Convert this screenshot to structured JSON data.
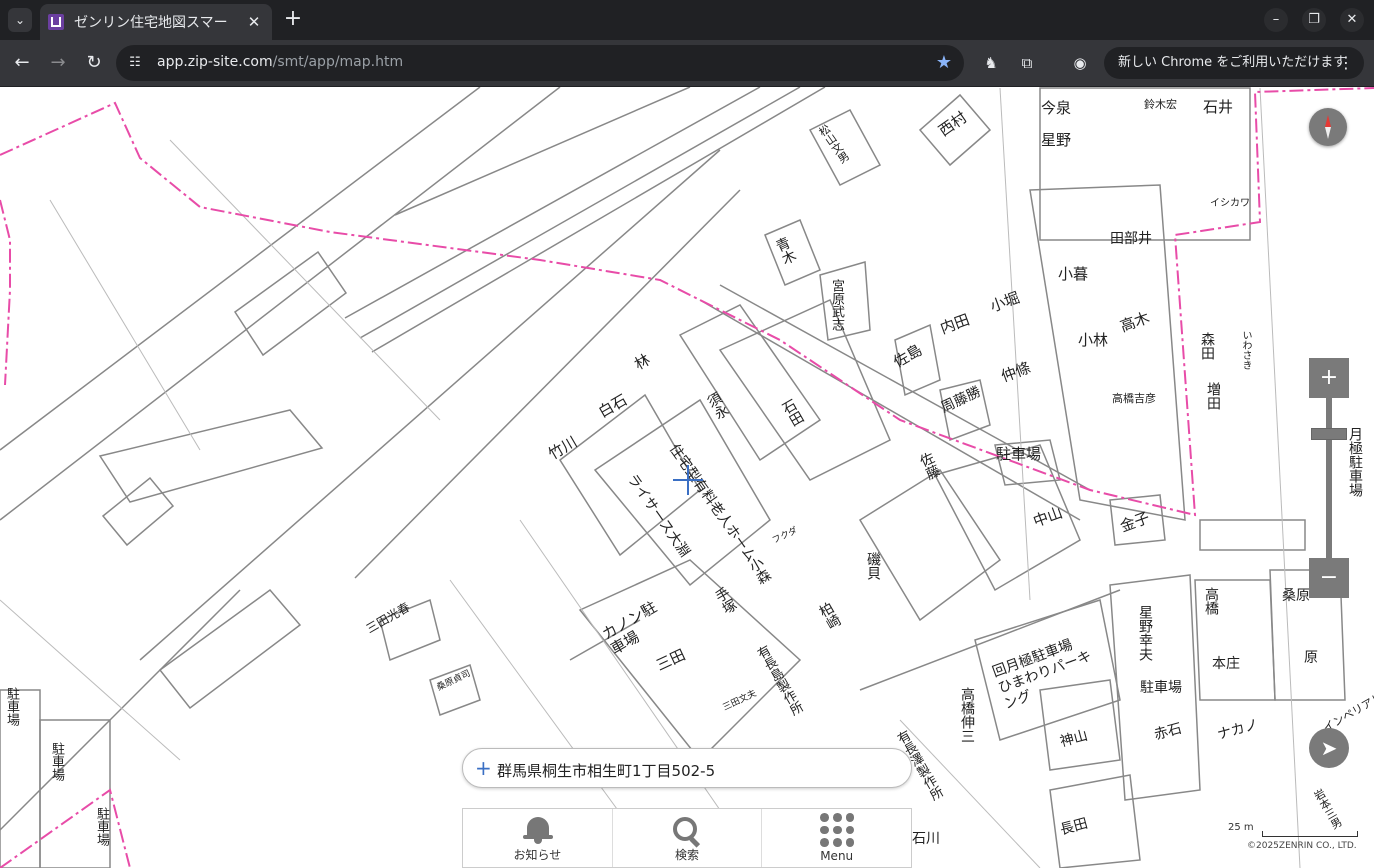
{
  "browser": {
    "tab_title": "ゼンリン住宅地図スマー",
    "url_host": "app.zip-site.com",
    "url_path": "/smt/app/map.htm",
    "update_label": "新しい Chrome をご利用いただけます",
    "icons": [
      "tab-search-icon",
      "favicon",
      "close-icon",
      "new-tab-icon",
      "minimize-icon",
      "restore-icon",
      "window-close-icon",
      "back-icon",
      "forward-icon",
      "reload-icon",
      "site-info-icon",
      "star-icon",
      "extension-icon",
      "puzzle-icon",
      "profile-icon",
      "more-icon"
    ]
  },
  "map": {
    "address": "群馬県桐生市相生町1丁目502-5",
    "scale": "25 m",
    "copyright": "©2025ZENRIN CO., LTD.",
    "menu": [
      {
        "label": "お知らせ",
        "icon": "bell-icon"
      },
      {
        "label": "検索",
        "icon": "search-icon"
      },
      {
        "label": "Menu",
        "icon": "menu-grid-icon"
      }
    ],
    "labels": {
      "imaizumi": "今泉",
      "hoshino": "星野",
      "suzuki": "鈴木宏",
      "ishii": "石井",
      "nishimura": "西村",
      "matsuyama": "松山文男",
      "aoki": "青木",
      "miyahara": "宮原武志",
      "tabei": "田部井",
      "kogure": "小暮",
      "kobayashi": "小林",
      "takagi": "高木",
      "takahashi": "高橋吉彦",
      "kobori": "小堀",
      "uchida": "内田",
      "sato": "佐島",
      "nakajo": "仲條",
      "shuto": "周藤勝",
      "chusha1": "駐車場",
      "hayashi": "林",
      "shiraishi": "白石",
      "sumi": "須永",
      "ishida": "石田",
      "takegawa": "竹川",
      "jutaku": "住宅型有料老人ホーム",
      "raisa": "ライサース大淵",
      "sato2": "佐藤",
      "nakayama": "中山",
      "kaneko": "金子",
      "mori": "森田",
      "masuda": "増田",
      "iwasaki": "いわさき",
      "ishikawa": "イシカワ",
      "canon": "カノン駐車場",
      "mitaka": "三田光春",
      "mita": "三田",
      "komori": "小森",
      "tezuka": "手塚",
      "isogai": "磯貝",
      "kashiwa": "柏崎",
      "seisakusho": "有長島製作所",
      "kuwabara": "桑原",
      "hara": "原",
      "hoshino2": "星野幸夫",
      "takahashi2": "高橋",
      "chusha2": "駐車場",
      "honjo": "本庄",
      "akaishi": "赤石",
      "nakano": "ナカノ",
      "kamiyama": "神山",
      "nagata": "長田",
      "himawari": "回月極駐車場 ひまわりパーキング",
      "takahashi3": "高橋伸三",
      "seisaku2": "有長澤製作所",
      "chusha3": "駐車場",
      "chusha4": "駐車場",
      "chusha5": "駐車場",
      "kuwabara2": "桑原貞司",
      "fukuda": "フクダ",
      "mitanobu": "三田文夫",
      "imperial": "インペリアル",
      "iwamoto": "岩本三男",
      "chusha6": "月極駐車場",
      "ishikawa2": "石川"
    }
  }
}
